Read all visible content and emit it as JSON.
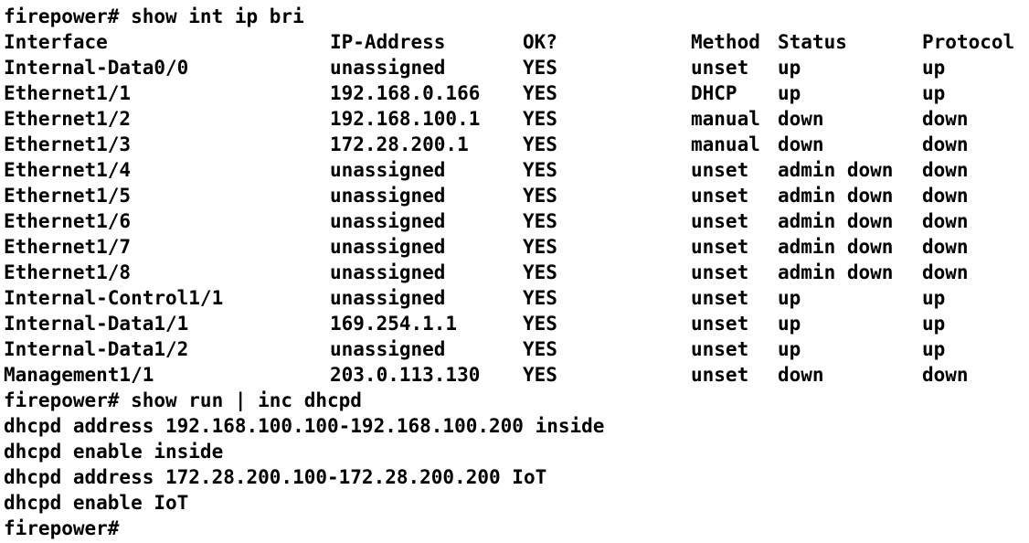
{
  "terminal": {
    "prompt1": "firepower# show int ip bri",
    "headers": {
      "interface": "Interface",
      "ip": "IP-Address",
      "ok": "OK?",
      "method": "Method",
      "status": "Status",
      "protocol": "Protocol"
    },
    "rows": [
      {
        "interface": "Internal-Data0/0",
        "ip": "unassigned",
        "ok": "YES",
        "method": "unset",
        "status": "up",
        "protocol": "up"
      },
      {
        "interface": "Ethernet1/1",
        "ip": "192.168.0.166",
        "ok": "YES",
        "method": "DHCP",
        "status": "up",
        "protocol": "up"
      },
      {
        "interface": "Ethernet1/2",
        "ip": "192.168.100.1",
        "ok": "YES",
        "method": "manual",
        "status": "down",
        "protocol": "down"
      },
      {
        "interface": "Ethernet1/3",
        "ip": "172.28.200.1",
        "ok": "YES",
        "method": "manual",
        "status": "down",
        "protocol": "down"
      },
      {
        "interface": "Ethernet1/4",
        "ip": "unassigned",
        "ok": "YES",
        "method": "unset",
        "status": "admin down",
        "protocol": "down"
      },
      {
        "interface": "Ethernet1/5",
        "ip": "unassigned",
        "ok": "YES",
        "method": "unset",
        "status": "admin down",
        "protocol": "down"
      },
      {
        "interface": "Ethernet1/6",
        "ip": "unassigned",
        "ok": "YES",
        "method": "unset",
        "status": "admin down",
        "protocol": "down"
      },
      {
        "interface": "Ethernet1/7",
        "ip": "unassigned",
        "ok": "YES",
        "method": "unset",
        "status": "admin down",
        "protocol": "down"
      },
      {
        "interface": "Ethernet1/8",
        "ip": "unassigned",
        "ok": "YES",
        "method": "unset",
        "status": "admin down",
        "protocol": "down"
      },
      {
        "interface": "Internal-Control1/1",
        "ip": "unassigned",
        "ok": "YES",
        "method": "unset",
        "status": "up",
        "protocol": "up"
      },
      {
        "interface": "Internal-Data1/1",
        "ip": "169.254.1.1",
        "ok": "YES",
        "method": "unset",
        "status": "up",
        "protocol": "up"
      },
      {
        "interface": "Internal-Data1/2",
        "ip": "unassigned",
        "ok": "YES",
        "method": "unset",
        "status": "up",
        "protocol": "up"
      },
      {
        "interface": "Management1/1",
        "ip": "203.0.113.130",
        "ok": "YES",
        "method": "unset",
        "status": "down",
        "protocol": "down"
      }
    ],
    "prompt2": "firepower# show run | inc dhcpd",
    "dhcp_lines": [
      "dhcpd address 192.168.100.100-192.168.100.200 inside",
      "dhcpd enable inside",
      "dhcpd address 172.28.200.100-172.28.200.200 IoT",
      "dhcpd enable IoT"
    ],
    "prompt3": "firepower#"
  }
}
